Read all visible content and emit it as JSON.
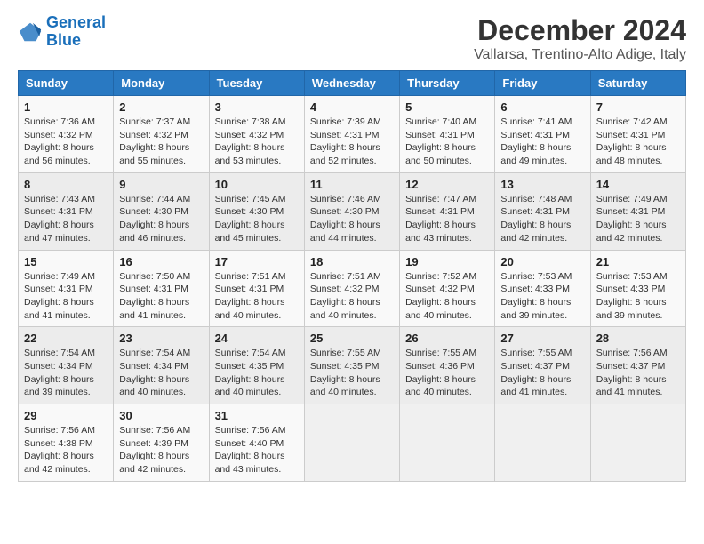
{
  "logo": {
    "line1": "General",
    "line2": "Blue"
  },
  "title": "December 2024",
  "subtitle": "Vallarsa, Trentino-Alto Adige, Italy",
  "days_of_week": [
    "Sunday",
    "Monday",
    "Tuesday",
    "Wednesday",
    "Thursday",
    "Friday",
    "Saturday"
  ],
  "weeks": [
    [
      {
        "day": 1,
        "sunrise": "7:36 AM",
        "sunset": "4:32 PM",
        "daylight": "8 hours and 56 minutes."
      },
      {
        "day": 2,
        "sunrise": "7:37 AM",
        "sunset": "4:32 PM",
        "daylight": "8 hours and 55 minutes."
      },
      {
        "day": 3,
        "sunrise": "7:38 AM",
        "sunset": "4:32 PM",
        "daylight": "8 hours and 53 minutes."
      },
      {
        "day": 4,
        "sunrise": "7:39 AM",
        "sunset": "4:31 PM",
        "daylight": "8 hours and 52 minutes."
      },
      {
        "day": 5,
        "sunrise": "7:40 AM",
        "sunset": "4:31 PM",
        "daylight": "8 hours and 50 minutes."
      },
      {
        "day": 6,
        "sunrise": "7:41 AM",
        "sunset": "4:31 PM",
        "daylight": "8 hours and 49 minutes."
      },
      {
        "day": 7,
        "sunrise": "7:42 AM",
        "sunset": "4:31 PM",
        "daylight": "8 hours and 48 minutes."
      }
    ],
    [
      {
        "day": 8,
        "sunrise": "7:43 AM",
        "sunset": "4:31 PM",
        "daylight": "8 hours and 47 minutes."
      },
      {
        "day": 9,
        "sunrise": "7:44 AM",
        "sunset": "4:30 PM",
        "daylight": "8 hours and 46 minutes."
      },
      {
        "day": 10,
        "sunrise": "7:45 AM",
        "sunset": "4:30 PM",
        "daylight": "8 hours and 45 minutes."
      },
      {
        "day": 11,
        "sunrise": "7:46 AM",
        "sunset": "4:30 PM",
        "daylight": "8 hours and 44 minutes."
      },
      {
        "day": 12,
        "sunrise": "7:47 AM",
        "sunset": "4:31 PM",
        "daylight": "8 hours and 43 minutes."
      },
      {
        "day": 13,
        "sunrise": "7:48 AM",
        "sunset": "4:31 PM",
        "daylight": "8 hours and 42 minutes."
      },
      {
        "day": 14,
        "sunrise": "7:49 AM",
        "sunset": "4:31 PM",
        "daylight": "8 hours and 42 minutes."
      }
    ],
    [
      {
        "day": 15,
        "sunrise": "7:49 AM",
        "sunset": "4:31 PM",
        "daylight": "8 hours and 41 minutes."
      },
      {
        "day": 16,
        "sunrise": "7:50 AM",
        "sunset": "4:31 PM",
        "daylight": "8 hours and 41 minutes."
      },
      {
        "day": 17,
        "sunrise": "7:51 AM",
        "sunset": "4:31 PM",
        "daylight": "8 hours and 40 minutes."
      },
      {
        "day": 18,
        "sunrise": "7:51 AM",
        "sunset": "4:32 PM",
        "daylight": "8 hours and 40 minutes."
      },
      {
        "day": 19,
        "sunrise": "7:52 AM",
        "sunset": "4:32 PM",
        "daylight": "8 hours and 40 minutes."
      },
      {
        "day": 20,
        "sunrise": "7:53 AM",
        "sunset": "4:33 PM",
        "daylight": "8 hours and 39 minutes."
      },
      {
        "day": 21,
        "sunrise": "7:53 AM",
        "sunset": "4:33 PM",
        "daylight": "8 hours and 39 minutes."
      }
    ],
    [
      {
        "day": 22,
        "sunrise": "7:54 AM",
        "sunset": "4:34 PM",
        "daylight": "8 hours and 39 minutes."
      },
      {
        "day": 23,
        "sunrise": "7:54 AM",
        "sunset": "4:34 PM",
        "daylight": "8 hours and 40 minutes."
      },
      {
        "day": 24,
        "sunrise": "7:54 AM",
        "sunset": "4:35 PM",
        "daylight": "8 hours and 40 minutes."
      },
      {
        "day": 25,
        "sunrise": "7:55 AM",
        "sunset": "4:35 PM",
        "daylight": "8 hours and 40 minutes."
      },
      {
        "day": 26,
        "sunrise": "7:55 AM",
        "sunset": "4:36 PM",
        "daylight": "8 hours and 40 minutes."
      },
      {
        "day": 27,
        "sunrise": "7:55 AM",
        "sunset": "4:37 PM",
        "daylight": "8 hours and 41 minutes."
      },
      {
        "day": 28,
        "sunrise": "7:56 AM",
        "sunset": "4:37 PM",
        "daylight": "8 hours and 41 minutes."
      }
    ],
    [
      {
        "day": 29,
        "sunrise": "7:56 AM",
        "sunset": "4:38 PM",
        "daylight": "8 hours and 42 minutes."
      },
      {
        "day": 30,
        "sunrise": "7:56 AM",
        "sunset": "4:39 PM",
        "daylight": "8 hours and 42 minutes."
      },
      {
        "day": 31,
        "sunrise": "7:56 AM",
        "sunset": "4:40 PM",
        "daylight": "8 hours and 43 minutes."
      },
      null,
      null,
      null,
      null
    ]
  ]
}
